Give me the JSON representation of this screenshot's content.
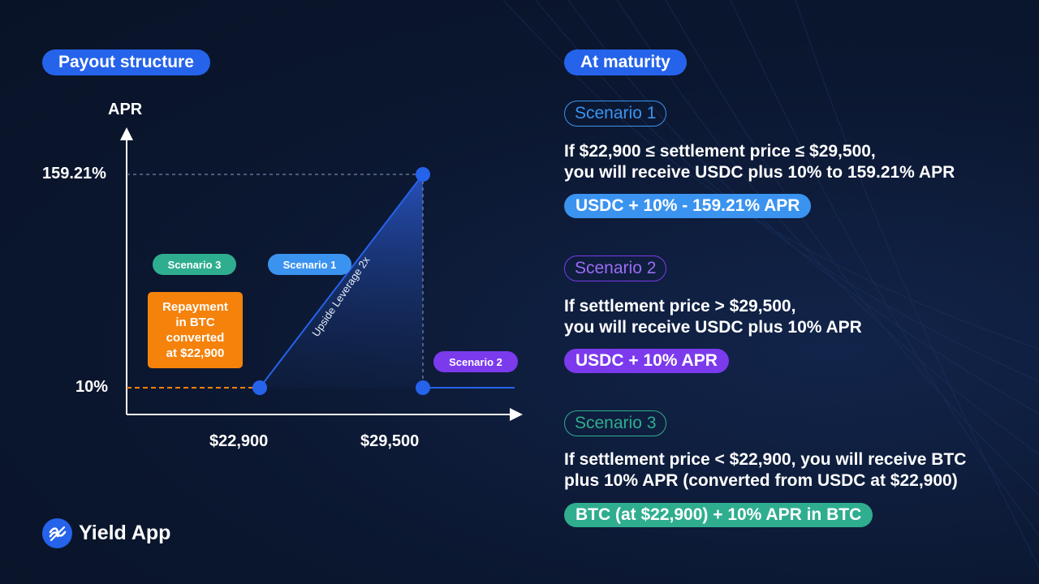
{
  "left": {
    "header": "Payout structure",
    "y_axis_label": "APR",
    "y_ticks": [
      "159.21%",
      "10%"
    ],
    "x_ticks": [
      "$22,900",
      "$29,500"
    ],
    "tags": {
      "scenario3": "Scenario 3",
      "scenario1": "Scenario 1",
      "scenario2": "Scenario 2"
    },
    "repayment_box": "Repayment\nin BTC\nconverted\nat $22,900",
    "leverage_label": "Upside Leverage 2x"
  },
  "chart_data": {
    "type": "line",
    "xlabel": "",
    "ylabel": "APR",
    "x_ticks": [
      "$22,900",
      "$29,500"
    ],
    "y_ticks": [
      "10%",
      "159.21%"
    ],
    "segments": [
      {
        "name": "Scenario 3",
        "from": [
          22900,
          10
        ],
        "to": null,
        "style": "dashed-orange",
        "note": ""
      },
      {
        "name": "Scenario 1",
        "from": [
          22900,
          10
        ],
        "to": [
          29500,
          159.21
        ]
      },
      {
        "name": "Scenario 2",
        "from": [
          29500,
          10
        ],
        "to": null
      }
    ],
    "points": [
      [
        22900,
        10
      ],
      [
        29500,
        159.21
      ],
      [
        29500,
        10
      ]
    ]
  },
  "right": {
    "header": "At maturity",
    "scenarios": [
      {
        "label": "Scenario 1",
        "line1": "If $22,900 ≤ settlement price ≤ $29,500,",
        "line2": "you will receive USDC plus 10% to 159.21% APR",
        "result": "USDC + 10% - 159.21% APR"
      },
      {
        "label": "Scenario 2",
        "line1": "If settlement price > $29,500,",
        "line2": "you will receive USDC plus 10% APR",
        "result": "USDC + 10% APR"
      },
      {
        "label": "Scenario 3",
        "line1": "If settlement price < $22,900, you will receive BTC",
        "line2": "plus 10% APR (converted from USDC at $22,900)",
        "result": "BTC (at $22,900) + 10% APR in BTC"
      }
    ]
  },
  "colors": {
    "bg": "#0b1730",
    "blue": "#2563eb",
    "sc1": "#3b93f0",
    "sc2": "#7c3aed",
    "sc3": "#2fae8f",
    "orange": "#f5820b"
  },
  "brand": {
    "name": "Yield App",
    "icon": "yield-app-logo-icon"
  }
}
